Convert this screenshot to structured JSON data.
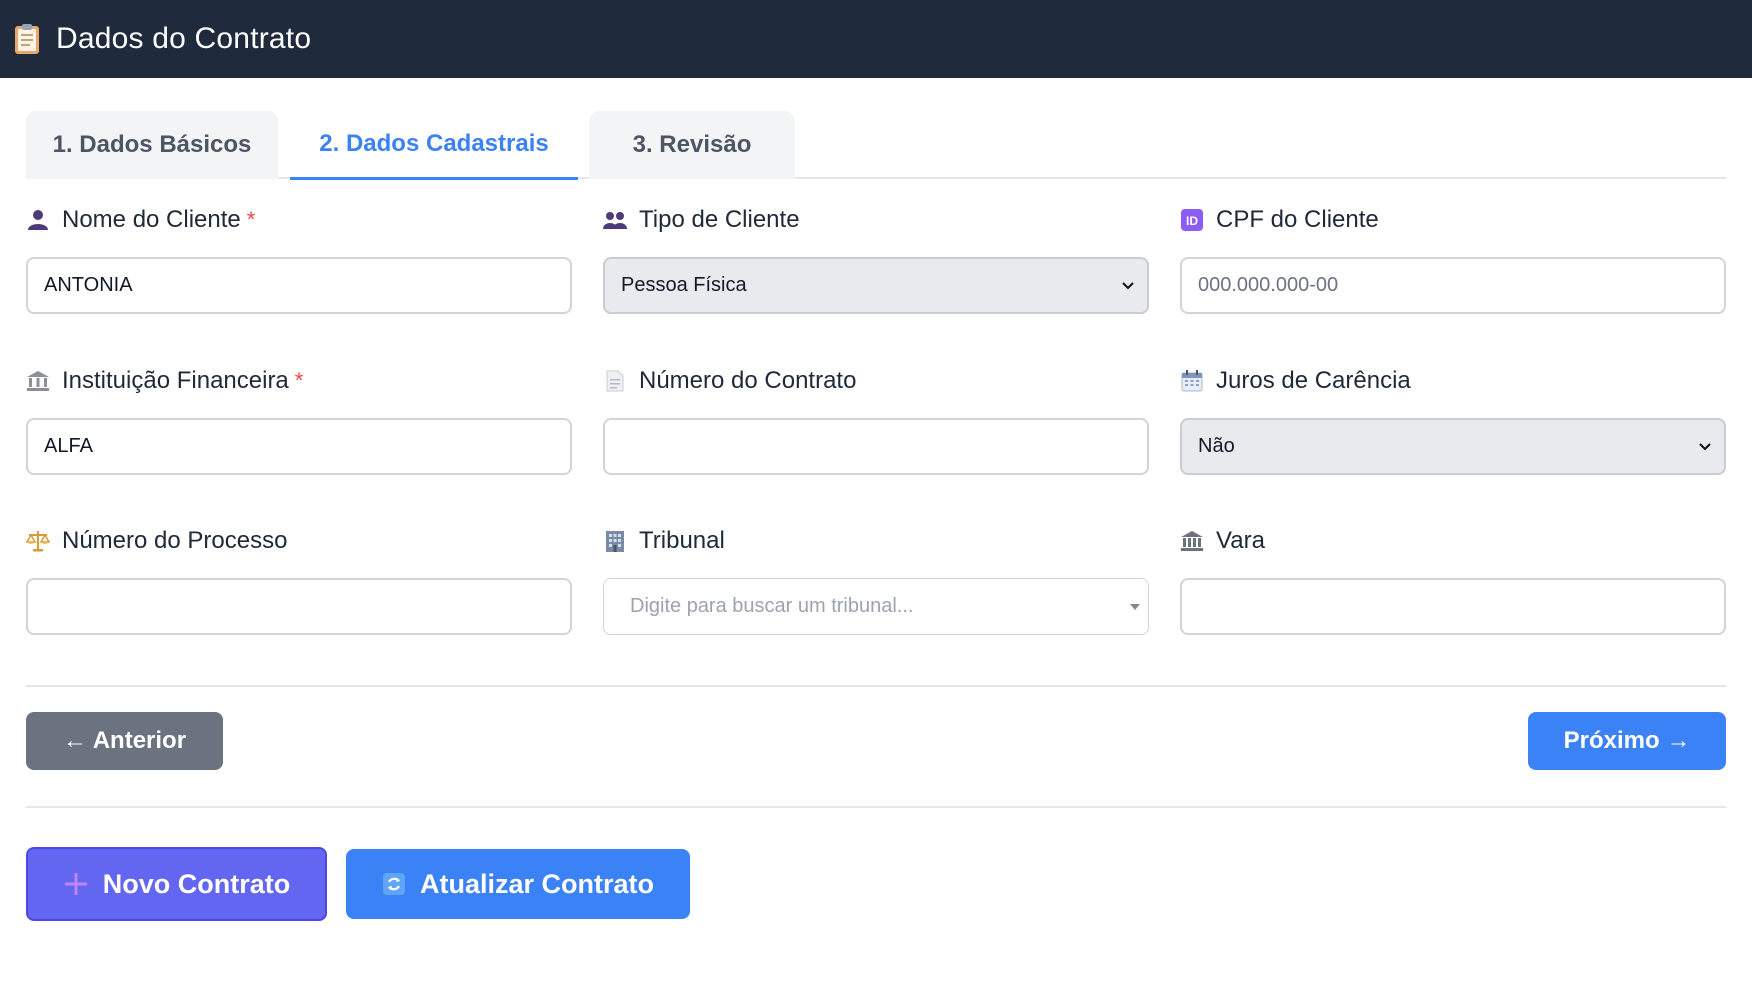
{
  "header": {
    "title": "Dados do Contrato",
    "icon": "clipboard-icon"
  },
  "tabs": [
    {
      "label": "1. Dados Básicos",
      "active": false
    },
    {
      "label": "2. Dados Cadastrais",
      "active": true
    },
    {
      "label": "3. Revisão",
      "active": false
    }
  ],
  "fields": {
    "nome_cliente": {
      "label": "Nome do Cliente",
      "required": "*",
      "value": "ANTONIA",
      "icon": "user-icon"
    },
    "tipo_cliente": {
      "label": "Tipo de Cliente",
      "value": "Pessoa Física",
      "icon": "users-icon"
    },
    "cpf_cliente": {
      "label": "CPF do Cliente",
      "placeholder": "000.000.000-00",
      "value": "",
      "icon": "id-icon"
    },
    "instituicao": {
      "label": "Instituição Financeira",
      "required": "*",
      "value": "ALFA",
      "icon": "bank-icon"
    },
    "numero_contrato": {
      "label": "Número do Contrato",
      "value": "",
      "icon": "document-icon"
    },
    "juros_carencia": {
      "label": "Juros de Carência",
      "value": "Não",
      "icon": "calendar-icon"
    },
    "numero_processo": {
      "label": "Número do Processo",
      "value": "",
      "icon": "scales-icon"
    },
    "tribunal": {
      "label": "Tribunal",
      "placeholder": "Digite para buscar um tribunal...",
      "icon": "office-building-icon"
    },
    "vara": {
      "label": "Vara",
      "value": "",
      "icon": "courthouse-icon"
    }
  },
  "nav": {
    "prev_label": "← Anterior",
    "next_label": "Próximo →"
  },
  "actions": {
    "new_label": "Novo Contrato",
    "update_label": "Atualizar Contrato"
  },
  "colors": {
    "header_bg": "#1f2a3d",
    "primary": "#3b82f6",
    "secondary": "#6b7280",
    "indigo": "#6366f1",
    "required": "#ef4444"
  }
}
